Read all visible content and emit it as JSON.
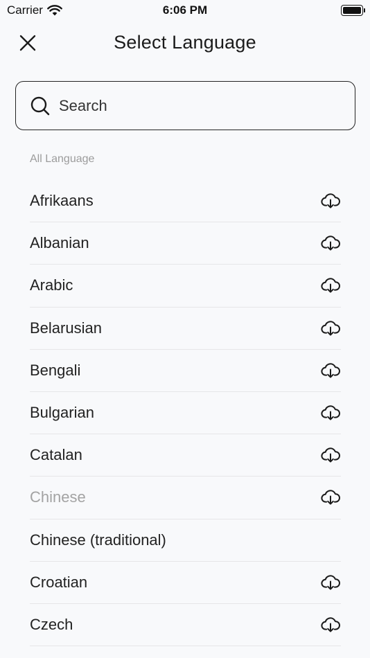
{
  "status_bar": {
    "carrier": "Carrier",
    "time": "6:06 PM"
  },
  "nav": {
    "title": "Select Language",
    "close_icon": "close-icon"
  },
  "search": {
    "placeholder": "Search",
    "value": "",
    "icon": "search-icon"
  },
  "section_label": "All Language",
  "languages": [
    {
      "name": "Afrikaans",
      "icon": "cloud-download-icon",
      "dimmed": false
    },
    {
      "name": "Albanian",
      "icon": "cloud-download-icon",
      "dimmed": false
    },
    {
      "name": "Arabic",
      "icon": "cloud-download-icon",
      "dimmed": false
    },
    {
      "name": "Belarusian",
      "icon": "cloud-download-icon",
      "dimmed": false
    },
    {
      "name": "Bengali",
      "icon": "cloud-download-icon",
      "dimmed": false
    },
    {
      "name": "Bulgarian",
      "icon": "cloud-download-icon",
      "dimmed": false
    },
    {
      "name": "Catalan",
      "icon": "cloud-download-icon",
      "dimmed": false
    },
    {
      "name": "Chinese",
      "icon": "cloud-download-icon",
      "dimmed": true
    },
    {
      "name": "Chinese (traditional)",
      "icon": "",
      "dimmed": false
    },
    {
      "name": "Croatian",
      "icon": "cloud-download-icon",
      "dimmed": false
    },
    {
      "name": "Czech",
      "icon": "cloud-download-icon",
      "dimmed": false
    }
  ],
  "colors": {
    "background": "#f8f9fb",
    "text": "#222222",
    "dimmed_text": "#a3a3a3",
    "section_label": "#9c9c9c",
    "divider": "#e6e6e8"
  }
}
